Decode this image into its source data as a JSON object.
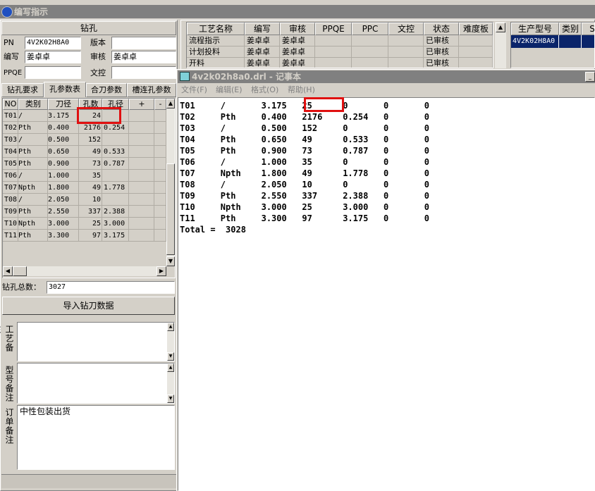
{
  "window": {
    "title": "编写指示"
  },
  "drill": {
    "header": "钻孔",
    "pn_label": "PN",
    "pn_value": "4V2K02H8A0",
    "version_label": "版本",
    "version_value": "",
    "editor_label": "编写",
    "editor_value": "姜卓卓",
    "reviewer_label": "审核",
    "reviewer_value": "姜卓卓",
    "ppqe_label": "PPQE",
    "ppqe_value": "",
    "doc_label": "文控",
    "doc_value": ""
  },
  "tabs": [
    "钻孔要求",
    "孔参数表",
    "合刀参数",
    "槽连孔参数"
  ],
  "hole_table": {
    "headers": [
      "NO",
      "类别",
      "刀径",
      "孔数",
      "孔径",
      "+",
      "-"
    ],
    "rows": [
      [
        "T01",
        "/",
        "3.175",
        "24",
        ""
      ],
      [
        "T02",
        "Pth",
        "0.400",
        "2176",
        "0.254"
      ],
      [
        "T03",
        "/",
        "0.500",
        "152",
        ""
      ],
      [
        "T04",
        "Pth",
        "0.650",
        "49",
        "0.533"
      ],
      [
        "T05",
        "Pth",
        "0.900",
        "73",
        "0.787"
      ],
      [
        "T06",
        "/",
        "1.000",
        "35",
        ""
      ],
      [
        "T07",
        "Npth",
        "1.800",
        "49",
        "1.778"
      ],
      [
        "T08",
        "/",
        "2.050",
        "10",
        ""
      ],
      [
        "T09",
        "Pth",
        "2.550",
        "337",
        "2.388"
      ],
      [
        "T10",
        "Npth",
        "3.000",
        "25",
        "3.000"
      ],
      [
        "T11",
        "Pth",
        "3.300",
        "97",
        "3.175"
      ]
    ]
  },
  "total_holes": {
    "label": "钻孔总数：",
    "value": "3027"
  },
  "import_button": "导入钻刀数据",
  "notes": [
    {
      "label": "工艺备注",
      "value": ""
    },
    {
      "label": "型号备注",
      "value": ""
    },
    {
      "label": "订单备注",
      "value": "中性包装出货"
    }
  ],
  "process_table": {
    "headers": [
      "工艺名称",
      "编写",
      "审核",
      "PPQE",
      "PPC",
      "文控",
      "状态",
      "难度板"
    ],
    "rows": [
      [
        "流程指示",
        "姜卓卓",
        "姜卓卓",
        "",
        "",
        "",
        "已审核",
        ""
      ],
      [
        "计划投料",
        "姜卓卓",
        "姜卓卓",
        "",
        "",
        "",
        "已审核",
        ""
      ],
      [
        "开料",
        "姜卓卓",
        "姜卓卓",
        "",
        "",
        "",
        "已审核",
        ""
      ]
    ]
  },
  "model_table": {
    "headers": [
      "生产型号",
      "类别",
      "S"
    ],
    "rows": [
      [
        "4V2K02H8A0",
        "",
        ""
      ]
    ]
  },
  "notepad": {
    "title": "4v2k02h8a0.drl - 记事本",
    "menu": [
      "文件(F)",
      "编辑(E)",
      "格式(O)",
      "帮助(H)"
    ],
    "lines": [
      "T01     /       3.175   25      0       0       0",
      "T02     Pth     0.400   2176    0.254   0       0",
      "T03     /       0.500   152     0       0       0",
      "T04     Pth     0.650   49      0.533   0       0",
      "T05     Pth     0.900   73      0.787   0       0",
      "T06     /       1.000   35      0       0       0",
      "T07     Npth    1.800   49      1.778   0       0",
      "T08     /       2.050   10      0       0       0",
      "T09     Pth     2.550   337     2.388   0       0",
      "T10     Npth    3.000   25      3.000   0       0",
      "T11     Pth     3.300   97      3.175   0       0",
      "Total =  3028"
    ]
  },
  "colors": {
    "titlebar": "#808080",
    "highlight": "#e01010",
    "selection": "#0a246a"
  }
}
